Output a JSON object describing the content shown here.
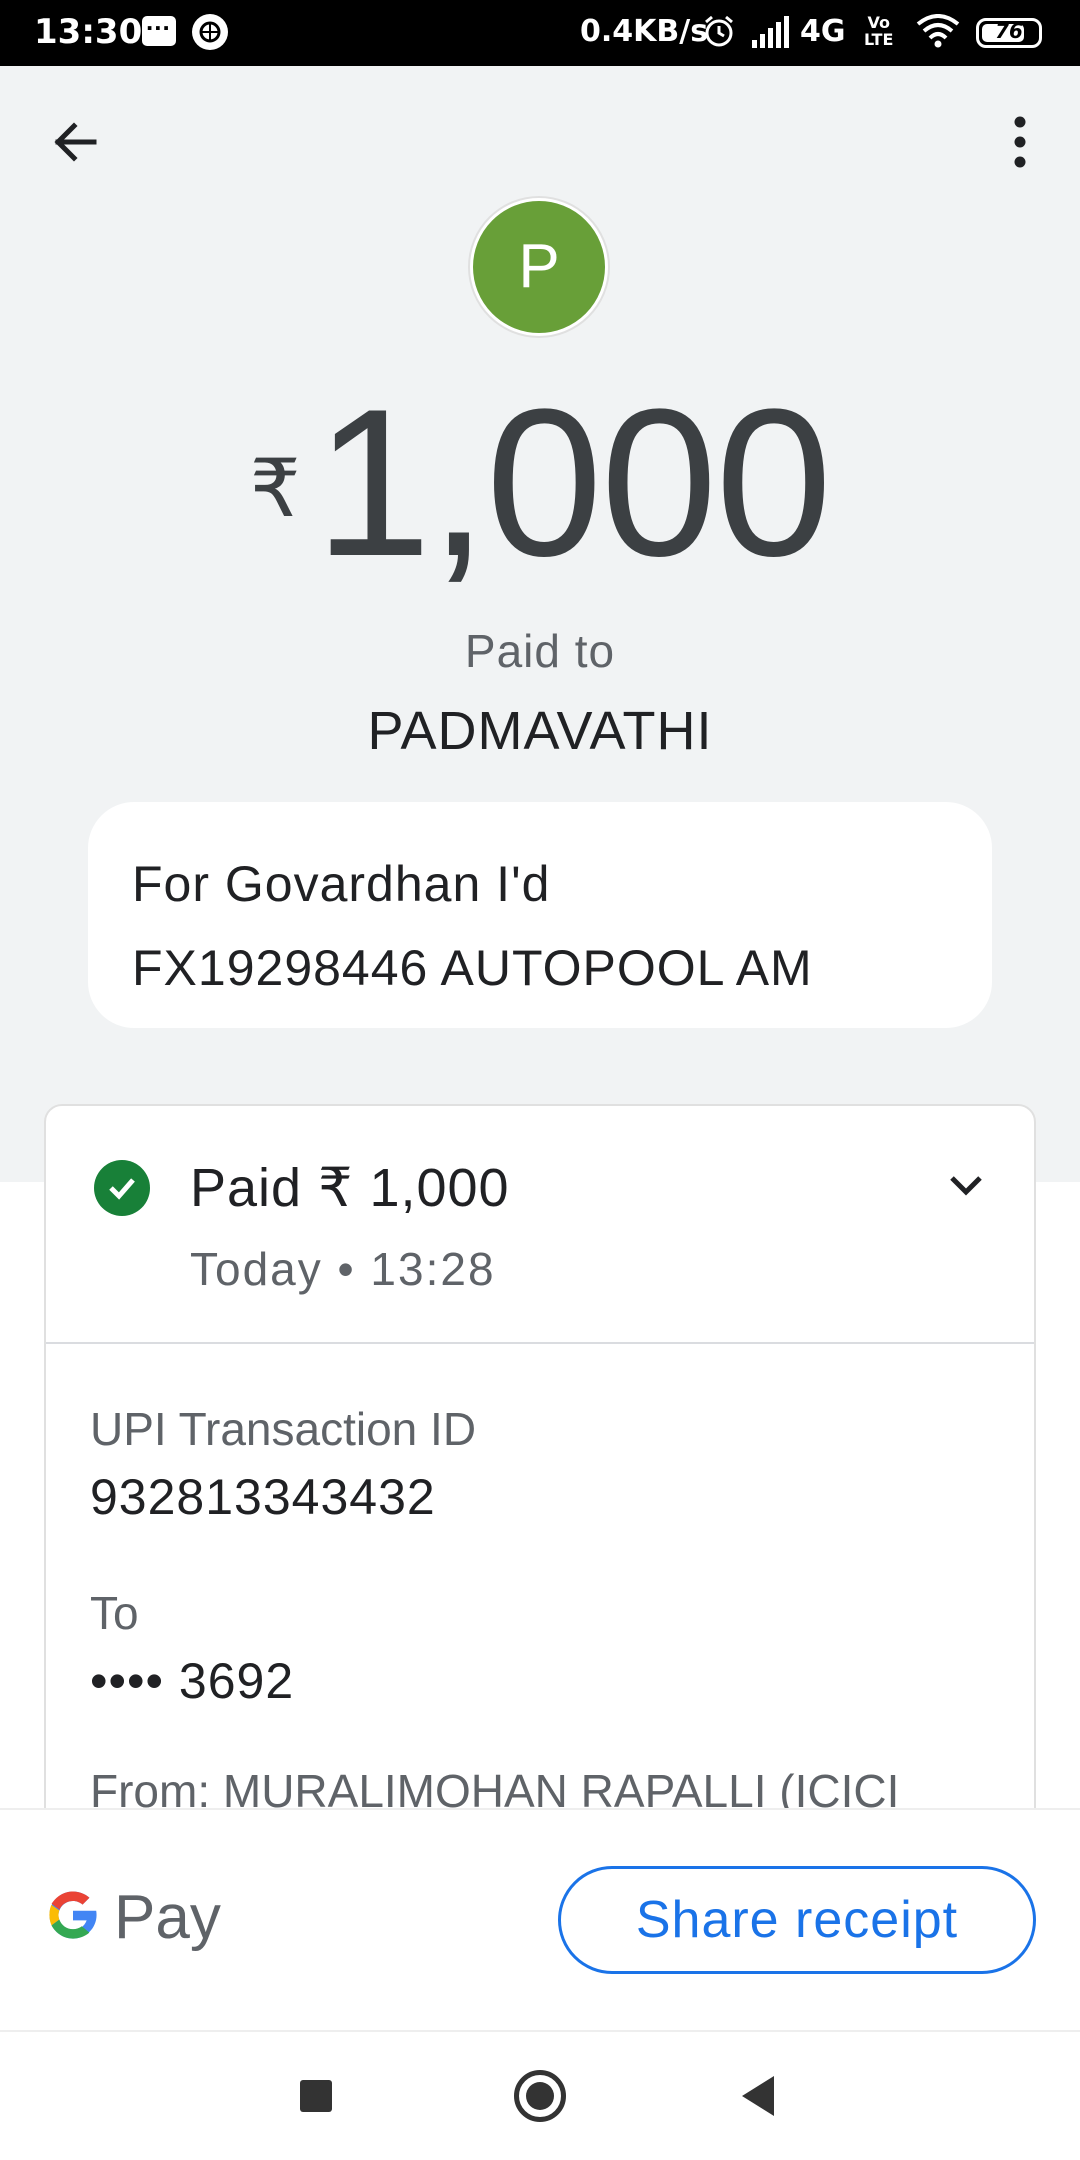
{
  "status_bar": {
    "time": "13:30",
    "net_speed": "0.4KB/s",
    "network": "4G",
    "volte_top": "Vo",
    "volte_bottom": "LTE",
    "battery": "76"
  },
  "header": {
    "avatar_letter": "P",
    "avatar_color": "#689f38",
    "currency": "₹",
    "amount": "1,000",
    "paid_to_label": "Paid to",
    "payee": "PADMAVATHI",
    "note_line1": "For Govardhan I'd",
    "note_line2": "FX19298446 AUTOPOOL AM"
  },
  "card": {
    "status_title": "Paid ₹ 1,000",
    "status_time": "Today • 13:28",
    "status_color": "#188038",
    "upi_label": "UPI Transaction ID",
    "upi_value": "932813343432",
    "to_label": "To",
    "to_value": "•••• 3692",
    "from_text": "From: MURALIMOHAN RAPALLI (ICICI"
  },
  "bottom": {
    "brand_text": "Pay",
    "share_label": "Share receipt",
    "accent": "#1a73e8"
  }
}
